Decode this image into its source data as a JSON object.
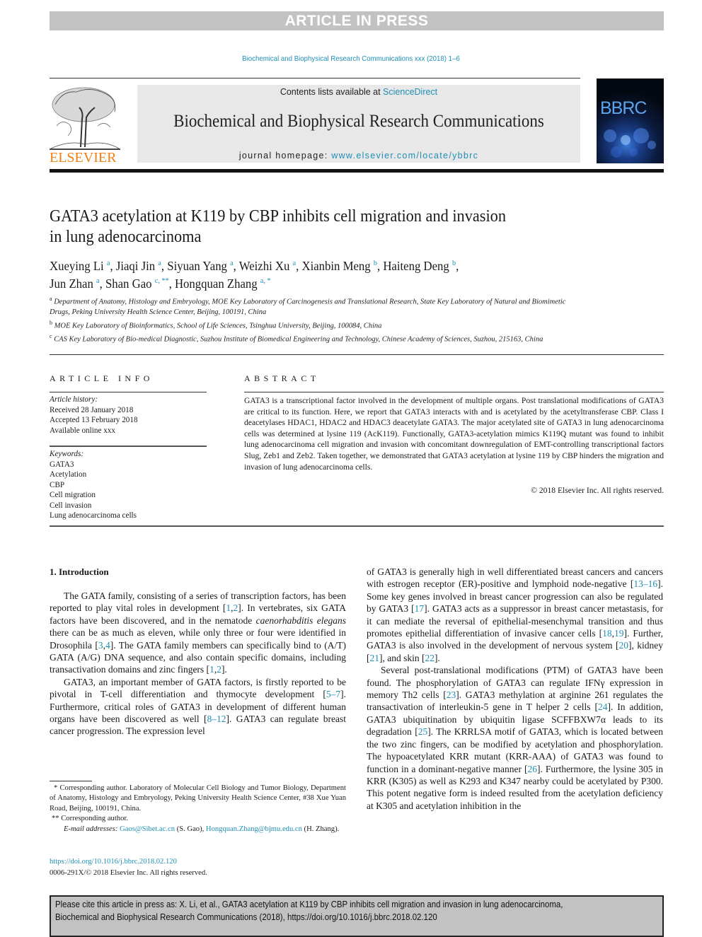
{
  "banner": {
    "text": "ARTICLE IN PRESS"
  },
  "journal_citation": "Biochemical and Biophysical Research Communications xxx (2018) 1–6",
  "masthead": {
    "publisher_wordmark": "ELSEVIER",
    "contents_prefix": "Contents lists available at ",
    "contents_link": "ScienceDirect",
    "journal_name": "Biochemical and Biophysical Research Communications",
    "homepage_prefix": "journal homepage: ",
    "homepage_link": "www.elsevier.com/locate/ybbrc",
    "cover_title": "BBRC",
    "colors": {
      "link": "#1f8fb5",
      "publisher_orange": "#f07f14",
      "banner_gray": "#c2c2c2",
      "masthead_gray": "#e8e8e8"
    }
  },
  "article": {
    "title_line1": "GATA3 acetylation at K119 by CBP inhibits cell migration and invasion",
    "title_line2": "in lung adenocarcinoma",
    "authors": [
      {
        "name": "Xueying Li",
        "sup": "a",
        "sep": ", "
      },
      {
        "name": "Jiaqi Jin",
        "sup": "a",
        "sep": ", "
      },
      {
        "name": "Siyuan Yang",
        "sup": "a",
        "sep": ", "
      },
      {
        "name": "Weizhi Xu",
        "sup": "a",
        "sep": ", "
      },
      {
        "name": "Xianbin Meng",
        "sup": "b",
        "sep": ", "
      },
      {
        "name": "Haiteng Deng",
        "sup": "b",
        "sep": ","
      },
      {
        "name": "Jun Zhan",
        "sup": "a",
        "sep": ", "
      },
      {
        "name": "Shan Gao",
        "sup": "c, **",
        "sep": ", "
      },
      {
        "name": "Hongquan Zhang",
        "sup": "a, *",
        "sep": ""
      }
    ],
    "affiliations": [
      {
        "label": "a",
        "text": "Department of Anatomy, Histology and Embryology, MOE Key Laboratory of Carcinogenesis and Translational Research, State Key Laboratory of Natural and Biomimetic Drugs, Peking University Health Science Center, Beijing, 100191, China"
      },
      {
        "label": "b",
        "text": "MOE Key Laboratory of Bioinformatics, School of Life Sciences, Tsinghua University, Beijing, 100084, China"
      },
      {
        "label": "c",
        "text": "CAS Key Laboratory of Bio-medical Diagnostic, Suzhou Institute of Biomedical Engineering and Technology, Chinese Academy of Sciences, Suzhou, 215163, China"
      }
    ]
  },
  "article_info": {
    "heading": "ARTICLE INFO",
    "history_label": "Article history:",
    "history": [
      "Received 28 January 2018",
      "Accepted 13 February 2018",
      "Available online xxx"
    ],
    "keywords_label": "Keywords:",
    "keywords": [
      "GATA3",
      "Acetylation",
      "CBP",
      "Cell migration",
      "Cell invasion",
      "Lung adenocarcinoma cells"
    ]
  },
  "abstract": {
    "heading": "ABSTRACT",
    "body": "GATA3 is a transcriptional factor involved in the development of multiple organs. Post translational modifications of GATA3 are critical to its function. Here, we report that GATA3 interacts with and is acetylated by the acetyltransferase CBP. Class I deacetylases HDAC1, HDAC2 and HDAC3 deacetylate GATA3. The major acetylated site of GATA3 in lung adenocarcinoma cells was determined at lysine 119 (AcK119). Functionally, GATA3-acetylation mimics K119Q mutant was found to inhibit lung adenocarci­noma cell migration and invasion with concomitant downregulation of EMT-controlling transcriptional factors Slug, Zeb1 and Zeb2. Taken together, we demonstrated that GATA3 acetylation at lysine 119 by CBP hinders the migration and invasion of lung adenocarcinoma cells.",
    "copyright": "© 2018 Elsevier Inc. All rights reserved."
  },
  "intro": {
    "heading": "1.  Introduction",
    "left": {
      "p1": [
        {
          "t": "The GATA family, consisting of a series of transcription factors, has been reported to play vital roles in development "
        },
        {
          "t": "[",
          "ref": false
        },
        {
          "t": "1",
          "ref": true
        },
        {
          "t": ",",
          "ref": false
        },
        {
          "t": "2",
          "ref": true
        },
        {
          "t": "]. In vertebrates, six GATA factors have been discovered, and in the nematode "
        },
        {
          "t": "caenorhabditis elegans",
          "i": true
        },
        {
          "t": " there can be as much as eleven, while only three or four were identified in Drosophila ["
        },
        {
          "t": "3",
          "ref": true
        },
        {
          "t": ","
        },
        {
          "t": "4",
          "ref": true
        },
        {
          "t": "]. The GATA family members can specifically bind to (A/T) GATA (A/G) DNA sequence, and also contain specific domains, including transactivation domains and zinc fingers ["
        },
        {
          "t": "1",
          "ref": true
        },
        {
          "t": ","
        },
        {
          "t": "2",
          "ref": true
        },
        {
          "t": "]."
        }
      ],
      "p2": [
        {
          "t": "GATA3, an important member of GATA factors, is firstly reported to be pivotal in T-cell differentiation and thymocyte development ["
        },
        {
          "t": "5–7",
          "ref": true
        },
        {
          "t": "]. Furthermore, critical roles of GATA3 in development of different human organs have been discovered as well ["
        },
        {
          "t": "8–12",
          "ref": true
        },
        {
          "t": "]. GATA3 can regulate breast cancer progression. The expression level"
        }
      ]
    },
    "right": {
      "p1": [
        {
          "t": "of GATA3 is generally high in well differentiated breast cancers and cancers with estrogen receptor (ER)-positive and lymphoid node-negative ["
        },
        {
          "t": "13–16",
          "ref": true
        },
        {
          "t": "]. Some key genes involved in breast cancer progression can also be regulated by GATA3 ["
        },
        {
          "t": "17",
          "ref": true
        },
        {
          "t": "]. GATA3 acts as a suppressor in breast cancer metastasis, for it can mediate the reversal of epithelial-mesenchymal transition and thus promotes epithelial differentiation of invasive cancer cells ["
        },
        {
          "t": "18",
          "ref": true
        },
        {
          "t": ","
        },
        {
          "t": "19",
          "ref": true
        },
        {
          "t": "]. Further, GATA3 is also involved in the development of nervous system ["
        },
        {
          "t": "20",
          "ref": true
        },
        {
          "t": "], kidney ["
        },
        {
          "t": "21",
          "ref": true
        },
        {
          "t": "], and skin ["
        },
        {
          "t": "22",
          "ref": true
        },
        {
          "t": "]."
        }
      ],
      "p2": [
        {
          "t": "Several post-translational modifications (PTM) of GATA3 have been found. The phosphorylation of GATA3 can regulate IFNγ expression in memory Th2 cells ["
        },
        {
          "t": "23",
          "ref": true
        },
        {
          "t": "]. GATA3 methylation at arginine 261 regulates the transactivation of interleukin-5 gene in T helper 2 cells ["
        },
        {
          "t": "24",
          "ref": true
        },
        {
          "t": "]. In addition, GATA3 ubiquitination by ubiquitin ligase SCFFBXW7α leads to its degradation ["
        },
        {
          "t": "25",
          "ref": true
        },
        {
          "t": "]. The KRRLSA motif of GATA3, which is located between the two zinc fingers, can be modified by acetylation and phosphorylation. The hypoacetylated KRR mutant (KRR-AAA) of GATA3 was found to function in a dominant-negative manner ["
        },
        {
          "t": "26",
          "ref": true
        },
        {
          "t": "]. Furthermore, the lysine 305 in KRR (K305) as well as K293 and K347 nearby could be acetylated by P300. This potent negative form is indeed resulted from the acetylation deficiency at K305 and acetylation inhibition in the"
        }
      ]
    }
  },
  "footnotes": {
    "star1": "* Corresponding author. Laboratory of Molecular Cell Biology and Tumor Biology, Department of Anatomy, Histology and Embryology, Peking University Health Science Center, #38 Xue Yuan Road, Beijing, 100191, China.",
    "star2": "** Corresponding author.",
    "email_label": "E-mail addresses:",
    "email1": "Gaos@Sibet.ac.cn",
    "email1_owner": " (S. Gao), ",
    "email2": "Hongquan.Zhang@bjmu.edu.cn",
    "email2_owner": " (H. Zhang)."
  },
  "doi": {
    "link": "https://doi.org/10.1016/j.bbrc.2018.02.120",
    "issn_line": "0006-291X/© 2018 Elsevier Inc. All rights reserved."
  },
  "cite_box": {
    "line1": "Please cite this article in press as: X. Li, et al., GATA3 acetylation at K119 by CBP inhibits cell migration and invasion in lung adenocarcinoma,",
    "line2": "Biochemical and Biophysical Research Communications (2018), https://doi.org/10.1016/j.bbrc.2018.02.120"
  }
}
